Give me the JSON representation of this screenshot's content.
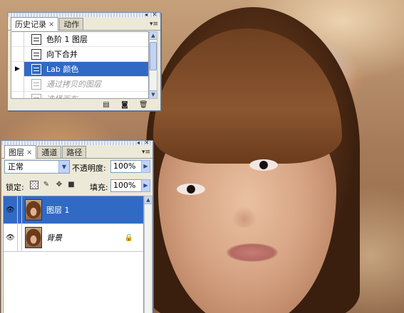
{
  "history_panel": {
    "tabs": [
      {
        "label": "历史记录",
        "active": true
      },
      {
        "label": "动作",
        "active": false
      }
    ],
    "items": [
      {
        "label": "色阶 1 图层",
        "state": "normal"
      },
      {
        "label": "向下合并",
        "state": "normal"
      },
      {
        "label": "Lab 颜色",
        "state": "selected"
      },
      {
        "label": "通过拷贝的图层",
        "state": "dimmed"
      },
      {
        "label": "选择画布",
        "state": "dimmed"
      }
    ],
    "footer_icons": [
      "new-document-icon",
      "camera-icon",
      "trash-icon"
    ]
  },
  "layers_panel": {
    "tabs": [
      {
        "label": "图层",
        "active": true
      },
      {
        "label": "通道",
        "active": false
      },
      {
        "label": "路径",
        "active": false
      }
    ],
    "blend_mode": "正常",
    "opacity_label": "不透明度:",
    "opacity_value": "100%",
    "lock_label": "锁定:",
    "fill_label": "填充:",
    "fill_value": "100%",
    "layers": [
      {
        "name": "图层 1",
        "selected": true,
        "visible": true,
        "locked": false
      },
      {
        "name": "背景",
        "selected": false,
        "visible": true,
        "locked": true
      }
    ]
  },
  "colors": {
    "selection": "#316ac5",
    "panel_bg": "#ece9d8"
  }
}
